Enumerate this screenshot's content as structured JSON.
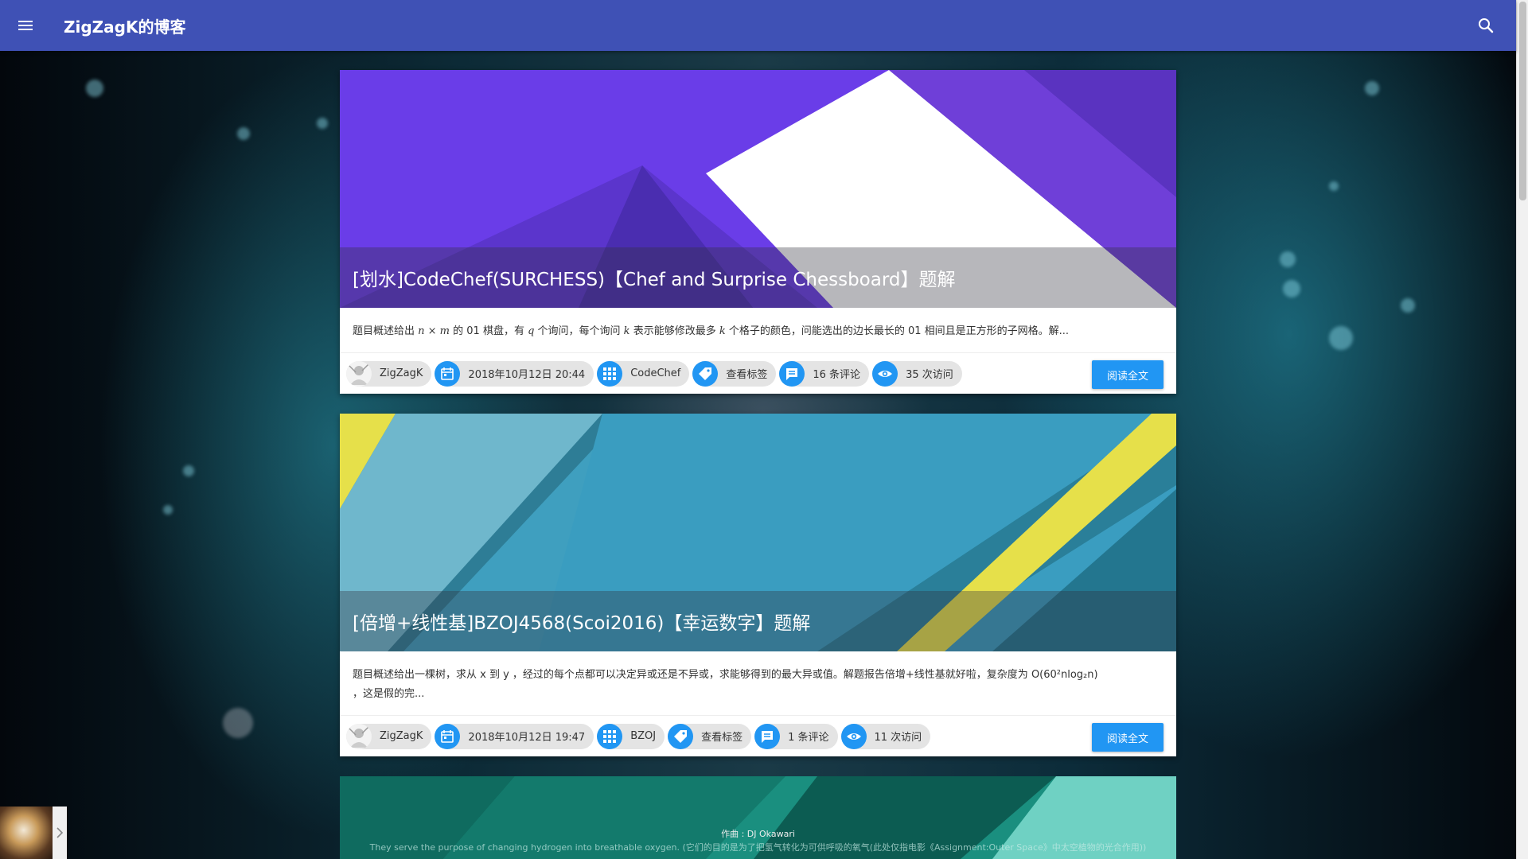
{
  "header": {
    "menu_icon": "menu-icon",
    "title": "ZigZagK的博客",
    "search_icon": "search-icon"
  },
  "posts": [
    {
      "title": "[划水]CodeChef(SURCHESS)【Chef and Surprise Chessboard】题解",
      "summary_parts": [
        "题目概述给出 ",
        "n × m",
        " 的 01 棋盘，有 ",
        "q",
        " 个询问，每个询问 ",
        "k",
        " 表示能够修改最多 ",
        "k",
        " 个格子的颜色，问能选出的边长最长的 01 相间且是正方形的子网格。解..."
      ],
      "author": "ZigZagK",
      "date": "2018年10月12日 20:44",
      "category": "CodeChef",
      "tags": "查看标签",
      "comments": "16 条评论",
      "views": "35 次访问",
      "read_more": "阅读全文",
      "banner_colors": [
        "#6a3de8",
        "#5b35cc",
        "#ffffff"
      ]
    },
    {
      "title": "[倍增+线性基]BZOJ4568(Scoi2016)【幸运数字】题解",
      "summary_line1": "题目概述给出一棵树，求从 x 到 y ，经过的每个点都可以决定异或还是不异或，求能够得到的最大异或值。解题报告倍增+线性基就好啦，复杂度为 O(60²nlog₂n)",
      "summary_line2": "，这是假的完...",
      "author": "ZigZagK",
      "date": "2018年10月12日 19:47",
      "category": "BZOJ",
      "tags": "查看标签",
      "comments": "1 条评论",
      "views": "11 次访问",
      "read_more": "阅读全文",
      "banner_colors": [
        "#3f9fbf",
        "#2a7f99",
        "#e6e04a"
      ]
    },
    {
      "banner_colors": [
        "#1a8f7f",
        "#0f6b5f",
        "#6fd1c3"
      ]
    }
  ],
  "player": {
    "credit": "作曲 : DJ Okawari",
    "lyric": "They serve the purpose of changing hydrogen into breathable oxygen. (它们的目的是为了把氢气转化为可供呼吸的氧气(此处仅指电影《Assignment:Outer Space》中太空植物的光合作用))"
  }
}
